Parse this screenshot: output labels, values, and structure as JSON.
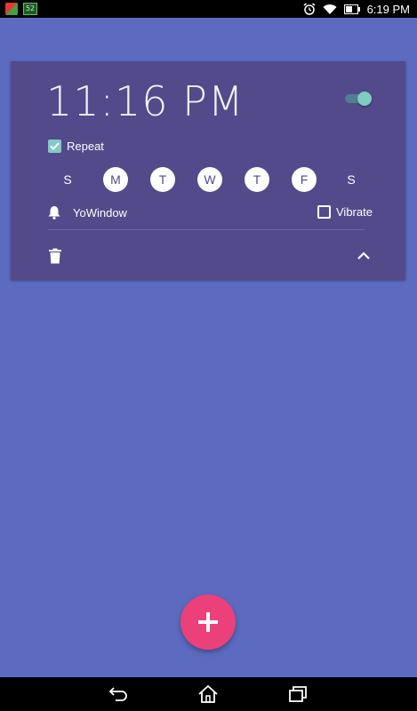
{
  "status_bar": {
    "time": "6:19 PM",
    "icons": [
      "app-icon",
      "battery-saver-icon",
      "alarm-icon",
      "wifi-icon",
      "battery-icon"
    ]
  },
  "alarm": {
    "time": "11:16 PM",
    "enabled": true,
    "repeat_label": "Repeat",
    "repeat_checked": true,
    "days": [
      {
        "label": "S",
        "selected": false
      },
      {
        "label": "M",
        "selected": true
      },
      {
        "label": "T",
        "selected": true
      },
      {
        "label": "W",
        "selected": true
      },
      {
        "label": "T",
        "selected": true
      },
      {
        "label": "F",
        "selected": true
      },
      {
        "label": "S",
        "selected": false
      }
    ],
    "ringtone": "YoWindow",
    "vibrate_label": "Vibrate",
    "vibrate_checked": false
  },
  "colors": {
    "background": "#5c6bc0",
    "card": "#524a8a",
    "accent": "#80cbc4",
    "fab": "#ec407a"
  },
  "navigation": {
    "icons": [
      "back-icon",
      "home-icon",
      "recent-apps-icon"
    ]
  }
}
